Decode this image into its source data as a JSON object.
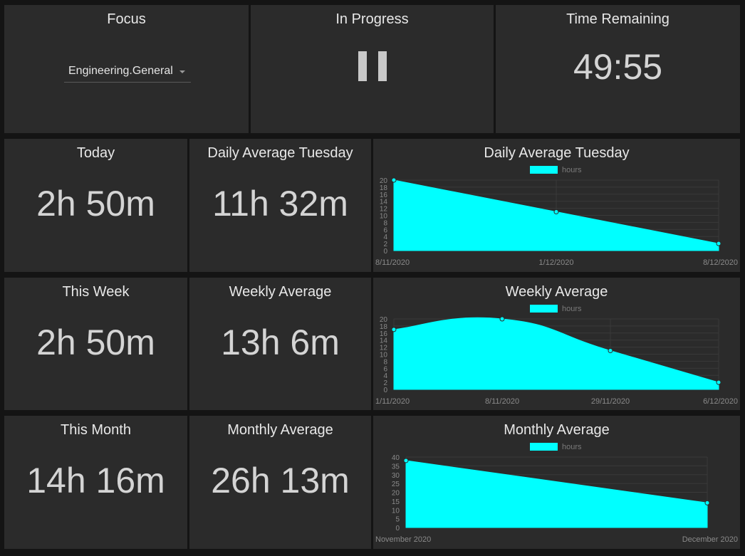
{
  "focus": {
    "title": "Focus",
    "selected": "Engineering.General"
  },
  "progress": {
    "title": "In Progress",
    "icon": "pause-icon"
  },
  "remaining": {
    "title": "Time Remaining",
    "value": "49:55"
  },
  "today": {
    "title": "Today",
    "value": "2h 50m"
  },
  "daily_avg": {
    "title": "Daily Average Tuesday",
    "value": "11h 32m"
  },
  "this_week": {
    "title": "This Week",
    "value": "2h 50m"
  },
  "weekly_avg": {
    "title": "Weekly Average",
    "value": "13h 6m"
  },
  "this_month": {
    "title": "This Month",
    "value": "14h 16m"
  },
  "monthly_avg": {
    "title": "Monthly Average",
    "value": "26h 13m"
  },
  "colors": {
    "fill": "#00ffff",
    "panel": "#2b2b2b",
    "background": "#141414"
  },
  "chart_data": [
    {
      "type": "area",
      "title": "Daily Average Tuesday",
      "legend": "top",
      "grid": true,
      "x": [
        "8/11/2020",
        "1/12/2020",
        "8/12/2020"
      ],
      "series": [
        {
          "name": "hours",
          "values": [
            20,
            11,
            2
          ]
        }
      ],
      "ylim": [
        0,
        20
      ],
      "yticks": [
        "0",
        "2",
        "4",
        "6",
        "8",
        "10",
        "12",
        "14",
        "16",
        "18",
        "20"
      ]
    },
    {
      "type": "area",
      "title": "Weekly Average",
      "legend": "top",
      "grid": true,
      "x": [
        "1/11/2020",
        "8/11/2020",
        "29/11/2020",
        "6/12/2020"
      ],
      "series": [
        {
          "name": "hours",
          "values": [
            17,
            20,
            11,
            2
          ]
        }
      ],
      "ylim": [
        0,
        20
      ],
      "yticks": [
        "0",
        "2",
        "4",
        "6",
        "8",
        "10",
        "12",
        "14",
        "16",
        "18",
        "20"
      ]
    },
    {
      "type": "area",
      "title": "Monthly Average",
      "legend": "top",
      "grid": true,
      "x": [
        "November 2020",
        "December 2020"
      ],
      "series": [
        {
          "name": "hours",
          "values": [
            38,
            14
          ]
        }
      ],
      "ylim": [
        0,
        40
      ],
      "yticks": [
        "0",
        "5",
        "10",
        "15",
        "20",
        "25",
        "30",
        "35",
        "40"
      ]
    }
  ]
}
